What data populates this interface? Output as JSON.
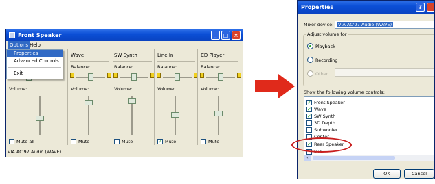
{
  "left_window": {
    "title": "Front Speaker",
    "menu": {
      "options": "Options",
      "help": "Help"
    },
    "dropdown": [
      "Properties",
      "Advanced Controls",
      "Exit"
    ],
    "columns": [
      {
        "name": "",
        "balance": "Balance:",
        "volume": "Volume:",
        "mute": "Mute all",
        "mute_checked": false
      },
      {
        "name": "Wave",
        "balance": "Balance:",
        "volume": "Volume:",
        "mute": "Mute",
        "mute_checked": false
      },
      {
        "name": "SW Synth",
        "balance": "Balance:",
        "volume": "Volume:",
        "mute": "Mute",
        "mute_checked": false
      },
      {
        "name": "Line In",
        "balance": "Balance:",
        "volume": "Volume:",
        "mute": "Mute",
        "mute_checked": true
      },
      {
        "name": "CD Player",
        "balance": "Balance:",
        "volume": "Volume:",
        "mute": "Mute",
        "mute_checked": false
      }
    ],
    "status": "VIA AC'97 Audio (WAVE)"
  },
  "right_window": {
    "title": "Properties",
    "help_glyph": "?",
    "mixer_label": "Mixer device:",
    "mixer_value": "VIA AC'97 Audio (WAVE)",
    "adjust_label": "Adjust volume for",
    "radios": [
      {
        "label": "Playback",
        "checked": true,
        "disabled": false
      },
      {
        "label": "Recording",
        "checked": false,
        "disabled": false
      },
      {
        "label": "Other",
        "checked": false,
        "disabled": true
      }
    ],
    "show_label": "Show the following volume controls:",
    "controls": [
      {
        "label": "Front Speaker",
        "checked": true
      },
      {
        "label": "Wave",
        "checked": true
      },
      {
        "label": "SW Synth",
        "checked": true
      },
      {
        "label": "3D Depth",
        "checked": false
      },
      {
        "label": "Subwoofer",
        "checked": false
      },
      {
        "label": "Center",
        "checked": false
      },
      {
        "label": "Rear Speaker",
        "checked": true
      },
      {
        "label": "Mic",
        "checked": false
      }
    ],
    "ok": "OK",
    "cancel": "Cancel"
  },
  "colors": {
    "arrow": "#e02a1b",
    "highlight_oval": "#c81e1e",
    "title_blue": "#0b4fd6"
  }
}
